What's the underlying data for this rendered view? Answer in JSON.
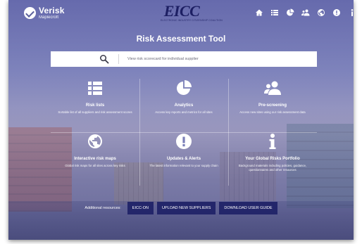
{
  "header": {
    "logo_name": "Verisk",
    "logo_sub": "Maplecroft",
    "brand_name": "EICC",
    "brand_tagline": "ELECTRONIC INDUSTRY CITIZENSHIP COALITION",
    "nav_icons": [
      "home-icon",
      "list-icon",
      "pie-chart-icon",
      "users-icon",
      "globe-icon",
      "alert-icon",
      "info-icon"
    ]
  },
  "main": {
    "title": "Risk Assessment Tool",
    "search": {
      "placeholder": "View risk scorecard for individual supplier"
    },
    "tiles": [
      {
        "icon": "list-icon",
        "title": "Risk lists",
        "desc": "Sortable list of all suppliers and risk assessment scores"
      },
      {
        "icon": "pie-chart-icon",
        "title": "Analytics",
        "desc": "Access key reports and metrics for all sites"
      },
      {
        "icon": "users-icon",
        "title": "Pre-screening",
        "desc": "Access new sites using our risk assessment data"
      },
      {
        "icon": "globe-icon",
        "title": "Interactive risk maps",
        "desc": "Global risk maps for all sites across key risks"
      },
      {
        "icon": "alert-icon",
        "title": "Updates & Alerts",
        "desc": "The latest information relevant to your supply chain"
      },
      {
        "icon": "info-icon",
        "title": "Your Global Risks Portfolio",
        "desc": "Background materials including policies, guidance, questionnaires and other resources"
      }
    ]
  },
  "resources": {
    "label": "Additional resources:",
    "buttons": [
      "EICC-ON",
      "UPLOAD NEW SUPPLIERS",
      "DOWNLOAD USER GUIDE"
    ]
  },
  "colors": {
    "button_bg": "#23266a",
    "brand": "#1d1f63",
    "overlay": "#6a6eb0"
  }
}
